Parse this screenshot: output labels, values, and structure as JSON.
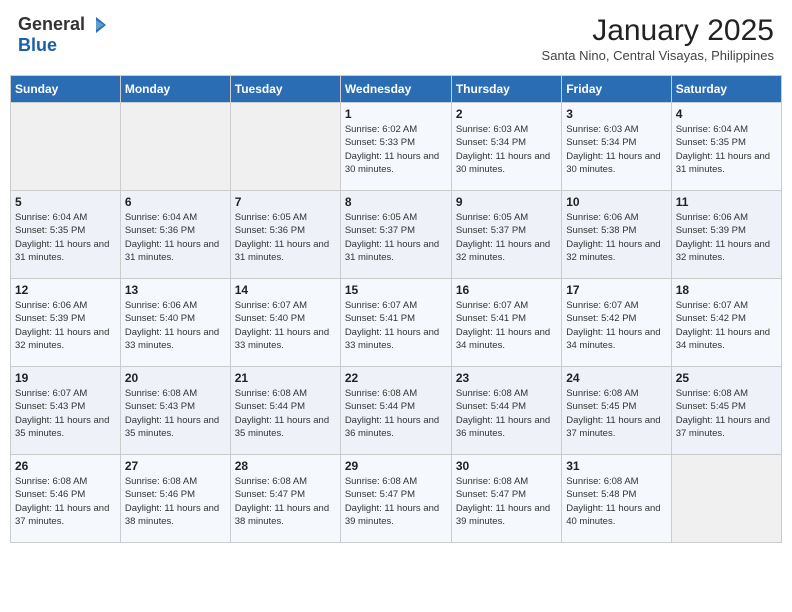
{
  "logo": {
    "general": "General",
    "blue": "Blue"
  },
  "title": "January 2025",
  "subtitle": "Santa Nino, Central Visayas, Philippines",
  "weekdays": [
    "Sunday",
    "Monday",
    "Tuesday",
    "Wednesday",
    "Thursday",
    "Friday",
    "Saturday"
  ],
  "weeks": [
    [
      {
        "day": "",
        "info": ""
      },
      {
        "day": "",
        "info": ""
      },
      {
        "day": "",
        "info": ""
      },
      {
        "day": "1",
        "info": "Sunrise: 6:02 AM\nSunset: 5:33 PM\nDaylight: 11 hours and 30 minutes."
      },
      {
        "day": "2",
        "info": "Sunrise: 6:03 AM\nSunset: 5:34 PM\nDaylight: 11 hours and 30 minutes."
      },
      {
        "day": "3",
        "info": "Sunrise: 6:03 AM\nSunset: 5:34 PM\nDaylight: 11 hours and 30 minutes."
      },
      {
        "day": "4",
        "info": "Sunrise: 6:04 AM\nSunset: 5:35 PM\nDaylight: 11 hours and 31 minutes."
      }
    ],
    [
      {
        "day": "5",
        "info": "Sunrise: 6:04 AM\nSunset: 5:35 PM\nDaylight: 11 hours and 31 minutes."
      },
      {
        "day": "6",
        "info": "Sunrise: 6:04 AM\nSunset: 5:36 PM\nDaylight: 11 hours and 31 minutes."
      },
      {
        "day": "7",
        "info": "Sunrise: 6:05 AM\nSunset: 5:36 PM\nDaylight: 11 hours and 31 minutes."
      },
      {
        "day": "8",
        "info": "Sunrise: 6:05 AM\nSunset: 5:37 PM\nDaylight: 11 hours and 31 minutes."
      },
      {
        "day": "9",
        "info": "Sunrise: 6:05 AM\nSunset: 5:37 PM\nDaylight: 11 hours and 32 minutes."
      },
      {
        "day": "10",
        "info": "Sunrise: 6:06 AM\nSunset: 5:38 PM\nDaylight: 11 hours and 32 minutes."
      },
      {
        "day": "11",
        "info": "Sunrise: 6:06 AM\nSunset: 5:39 PM\nDaylight: 11 hours and 32 minutes."
      }
    ],
    [
      {
        "day": "12",
        "info": "Sunrise: 6:06 AM\nSunset: 5:39 PM\nDaylight: 11 hours and 32 minutes."
      },
      {
        "day": "13",
        "info": "Sunrise: 6:06 AM\nSunset: 5:40 PM\nDaylight: 11 hours and 33 minutes."
      },
      {
        "day": "14",
        "info": "Sunrise: 6:07 AM\nSunset: 5:40 PM\nDaylight: 11 hours and 33 minutes."
      },
      {
        "day": "15",
        "info": "Sunrise: 6:07 AM\nSunset: 5:41 PM\nDaylight: 11 hours and 33 minutes."
      },
      {
        "day": "16",
        "info": "Sunrise: 6:07 AM\nSunset: 5:41 PM\nDaylight: 11 hours and 34 minutes."
      },
      {
        "day": "17",
        "info": "Sunrise: 6:07 AM\nSunset: 5:42 PM\nDaylight: 11 hours and 34 minutes."
      },
      {
        "day": "18",
        "info": "Sunrise: 6:07 AM\nSunset: 5:42 PM\nDaylight: 11 hours and 34 minutes."
      }
    ],
    [
      {
        "day": "19",
        "info": "Sunrise: 6:07 AM\nSunset: 5:43 PM\nDaylight: 11 hours and 35 minutes."
      },
      {
        "day": "20",
        "info": "Sunrise: 6:08 AM\nSunset: 5:43 PM\nDaylight: 11 hours and 35 minutes."
      },
      {
        "day": "21",
        "info": "Sunrise: 6:08 AM\nSunset: 5:44 PM\nDaylight: 11 hours and 35 minutes."
      },
      {
        "day": "22",
        "info": "Sunrise: 6:08 AM\nSunset: 5:44 PM\nDaylight: 11 hours and 36 minutes."
      },
      {
        "day": "23",
        "info": "Sunrise: 6:08 AM\nSunset: 5:44 PM\nDaylight: 11 hours and 36 minutes."
      },
      {
        "day": "24",
        "info": "Sunrise: 6:08 AM\nSunset: 5:45 PM\nDaylight: 11 hours and 37 minutes."
      },
      {
        "day": "25",
        "info": "Sunrise: 6:08 AM\nSunset: 5:45 PM\nDaylight: 11 hours and 37 minutes."
      }
    ],
    [
      {
        "day": "26",
        "info": "Sunrise: 6:08 AM\nSunset: 5:46 PM\nDaylight: 11 hours and 37 minutes."
      },
      {
        "day": "27",
        "info": "Sunrise: 6:08 AM\nSunset: 5:46 PM\nDaylight: 11 hours and 38 minutes."
      },
      {
        "day": "28",
        "info": "Sunrise: 6:08 AM\nSunset: 5:47 PM\nDaylight: 11 hours and 38 minutes."
      },
      {
        "day": "29",
        "info": "Sunrise: 6:08 AM\nSunset: 5:47 PM\nDaylight: 11 hours and 39 minutes."
      },
      {
        "day": "30",
        "info": "Sunrise: 6:08 AM\nSunset: 5:47 PM\nDaylight: 11 hours and 39 minutes."
      },
      {
        "day": "31",
        "info": "Sunrise: 6:08 AM\nSunset: 5:48 PM\nDaylight: 11 hours and 40 minutes."
      },
      {
        "day": "",
        "info": ""
      }
    ]
  ]
}
